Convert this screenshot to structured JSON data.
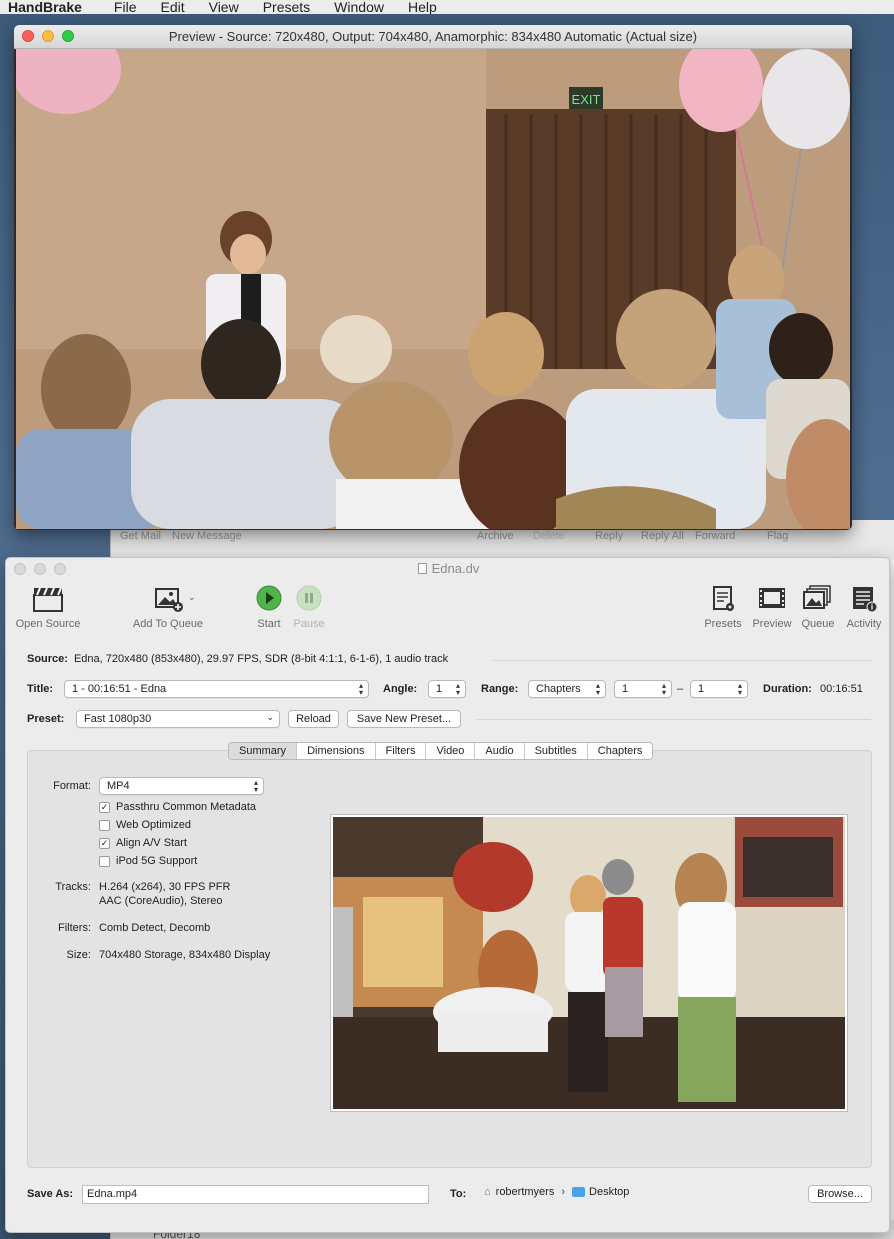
{
  "menubar": {
    "app": "HandBrake",
    "items": [
      "File",
      "Edit",
      "View",
      "Presets",
      "Window",
      "Help"
    ]
  },
  "mail": {
    "toolbar": [
      "Get Mail",
      "New Message",
      "Archive",
      "Delete",
      "Reply",
      "Reply All",
      "Forward",
      "Flag"
    ],
    "sidebar_bottom": "Folder18"
  },
  "preview_window": {
    "title": "Preview - Source: 720x480, Output: 704x480, Anamorphic: 834x480 Automatic (Actual size)",
    "sign": "EXIT"
  },
  "main_window": {
    "title": "Edna.dv",
    "toolbar": {
      "open_source": "Open Source",
      "add_to_queue": "Add To Queue",
      "start": "Start",
      "pause": "Pause",
      "presets": "Presets",
      "preview": "Preview",
      "queue": "Queue",
      "activity": "Activity"
    },
    "source": {
      "label": "Source:",
      "value": "Edna, 720x480 (853x480), 29.97 FPS, SDR (8-bit 4:1:1, 6-1-6), 1 audio track"
    },
    "title_row": {
      "title_label": "Title:",
      "title_value": "1 - 00:16:51 - Edna",
      "angle_label": "Angle:",
      "angle_value": "1",
      "range_label": "Range:",
      "range_type": "Chapters",
      "range_start": "1",
      "range_dash": "–",
      "range_end": "1",
      "duration_label": "Duration:",
      "duration_value": "00:16:51"
    },
    "preset_row": {
      "label": "Preset:",
      "value": "Fast 1080p30",
      "reload": "Reload",
      "save_new": "Save New Preset..."
    },
    "tabs": [
      "Summary",
      "Dimensions",
      "Filters",
      "Video",
      "Audio",
      "Subtitles",
      "Chapters"
    ],
    "active_tab": "Summary",
    "summary": {
      "format_label": "Format:",
      "format_value": "MP4",
      "options": [
        {
          "label": "Passthru Common Metadata",
          "checked": true
        },
        {
          "label": "Web Optimized",
          "checked": false
        },
        {
          "label": "Align A/V Start",
          "checked": true
        },
        {
          "label": "iPod 5G Support",
          "checked": false
        }
      ],
      "tracks_label": "Tracks:",
      "tracks_line1": "H.264 (x264), 30 FPS PFR",
      "tracks_line2": "AAC (CoreAudio), Stereo",
      "filters_label": "Filters:",
      "filters_value": "Comb Detect, Decomb",
      "size_label": "Size:",
      "size_value": "704x480 Storage, 834x480 Display"
    },
    "save": {
      "label": "Save As:",
      "value": "Edna.mp4",
      "to_label": "To:",
      "path_user": "robertmyers",
      "path_folder": "Desktop",
      "browse": "Browse..."
    }
  }
}
